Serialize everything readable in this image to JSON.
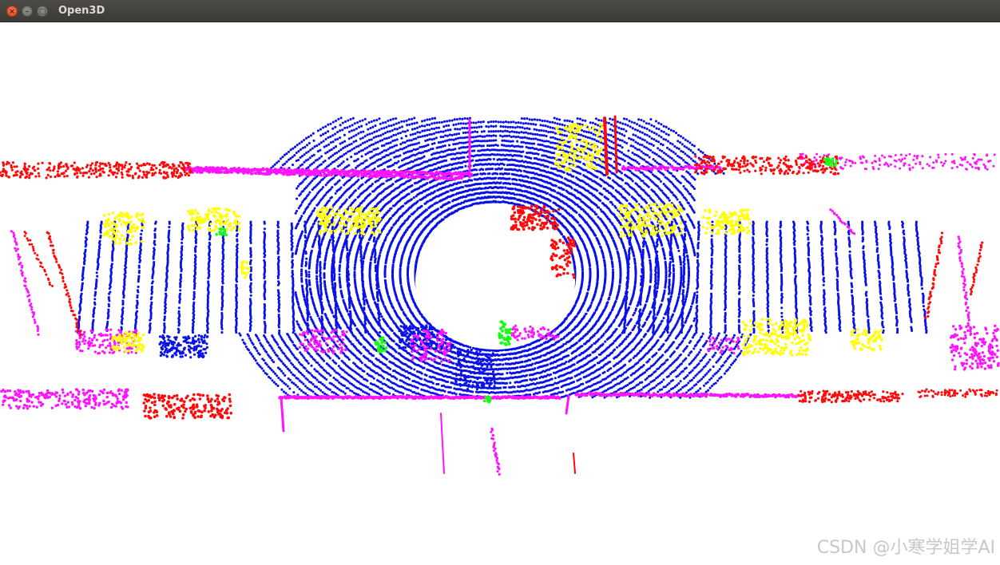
{
  "window": {
    "title": "Open3D",
    "controls": {
      "close_glyph": "×",
      "minimize_glyph": "–",
      "maximize_glyph": "□"
    }
  },
  "viewport": {
    "background": "#ffffff",
    "legend_colors": {
      "blue": "#0a12e8",
      "magenta": "#ff14ff",
      "red": "#ff0a0a",
      "yellow": "#ffff00",
      "green": "#14ff14"
    }
  },
  "watermark": {
    "text": "CSDN @小寒学姐学AI"
  }
}
